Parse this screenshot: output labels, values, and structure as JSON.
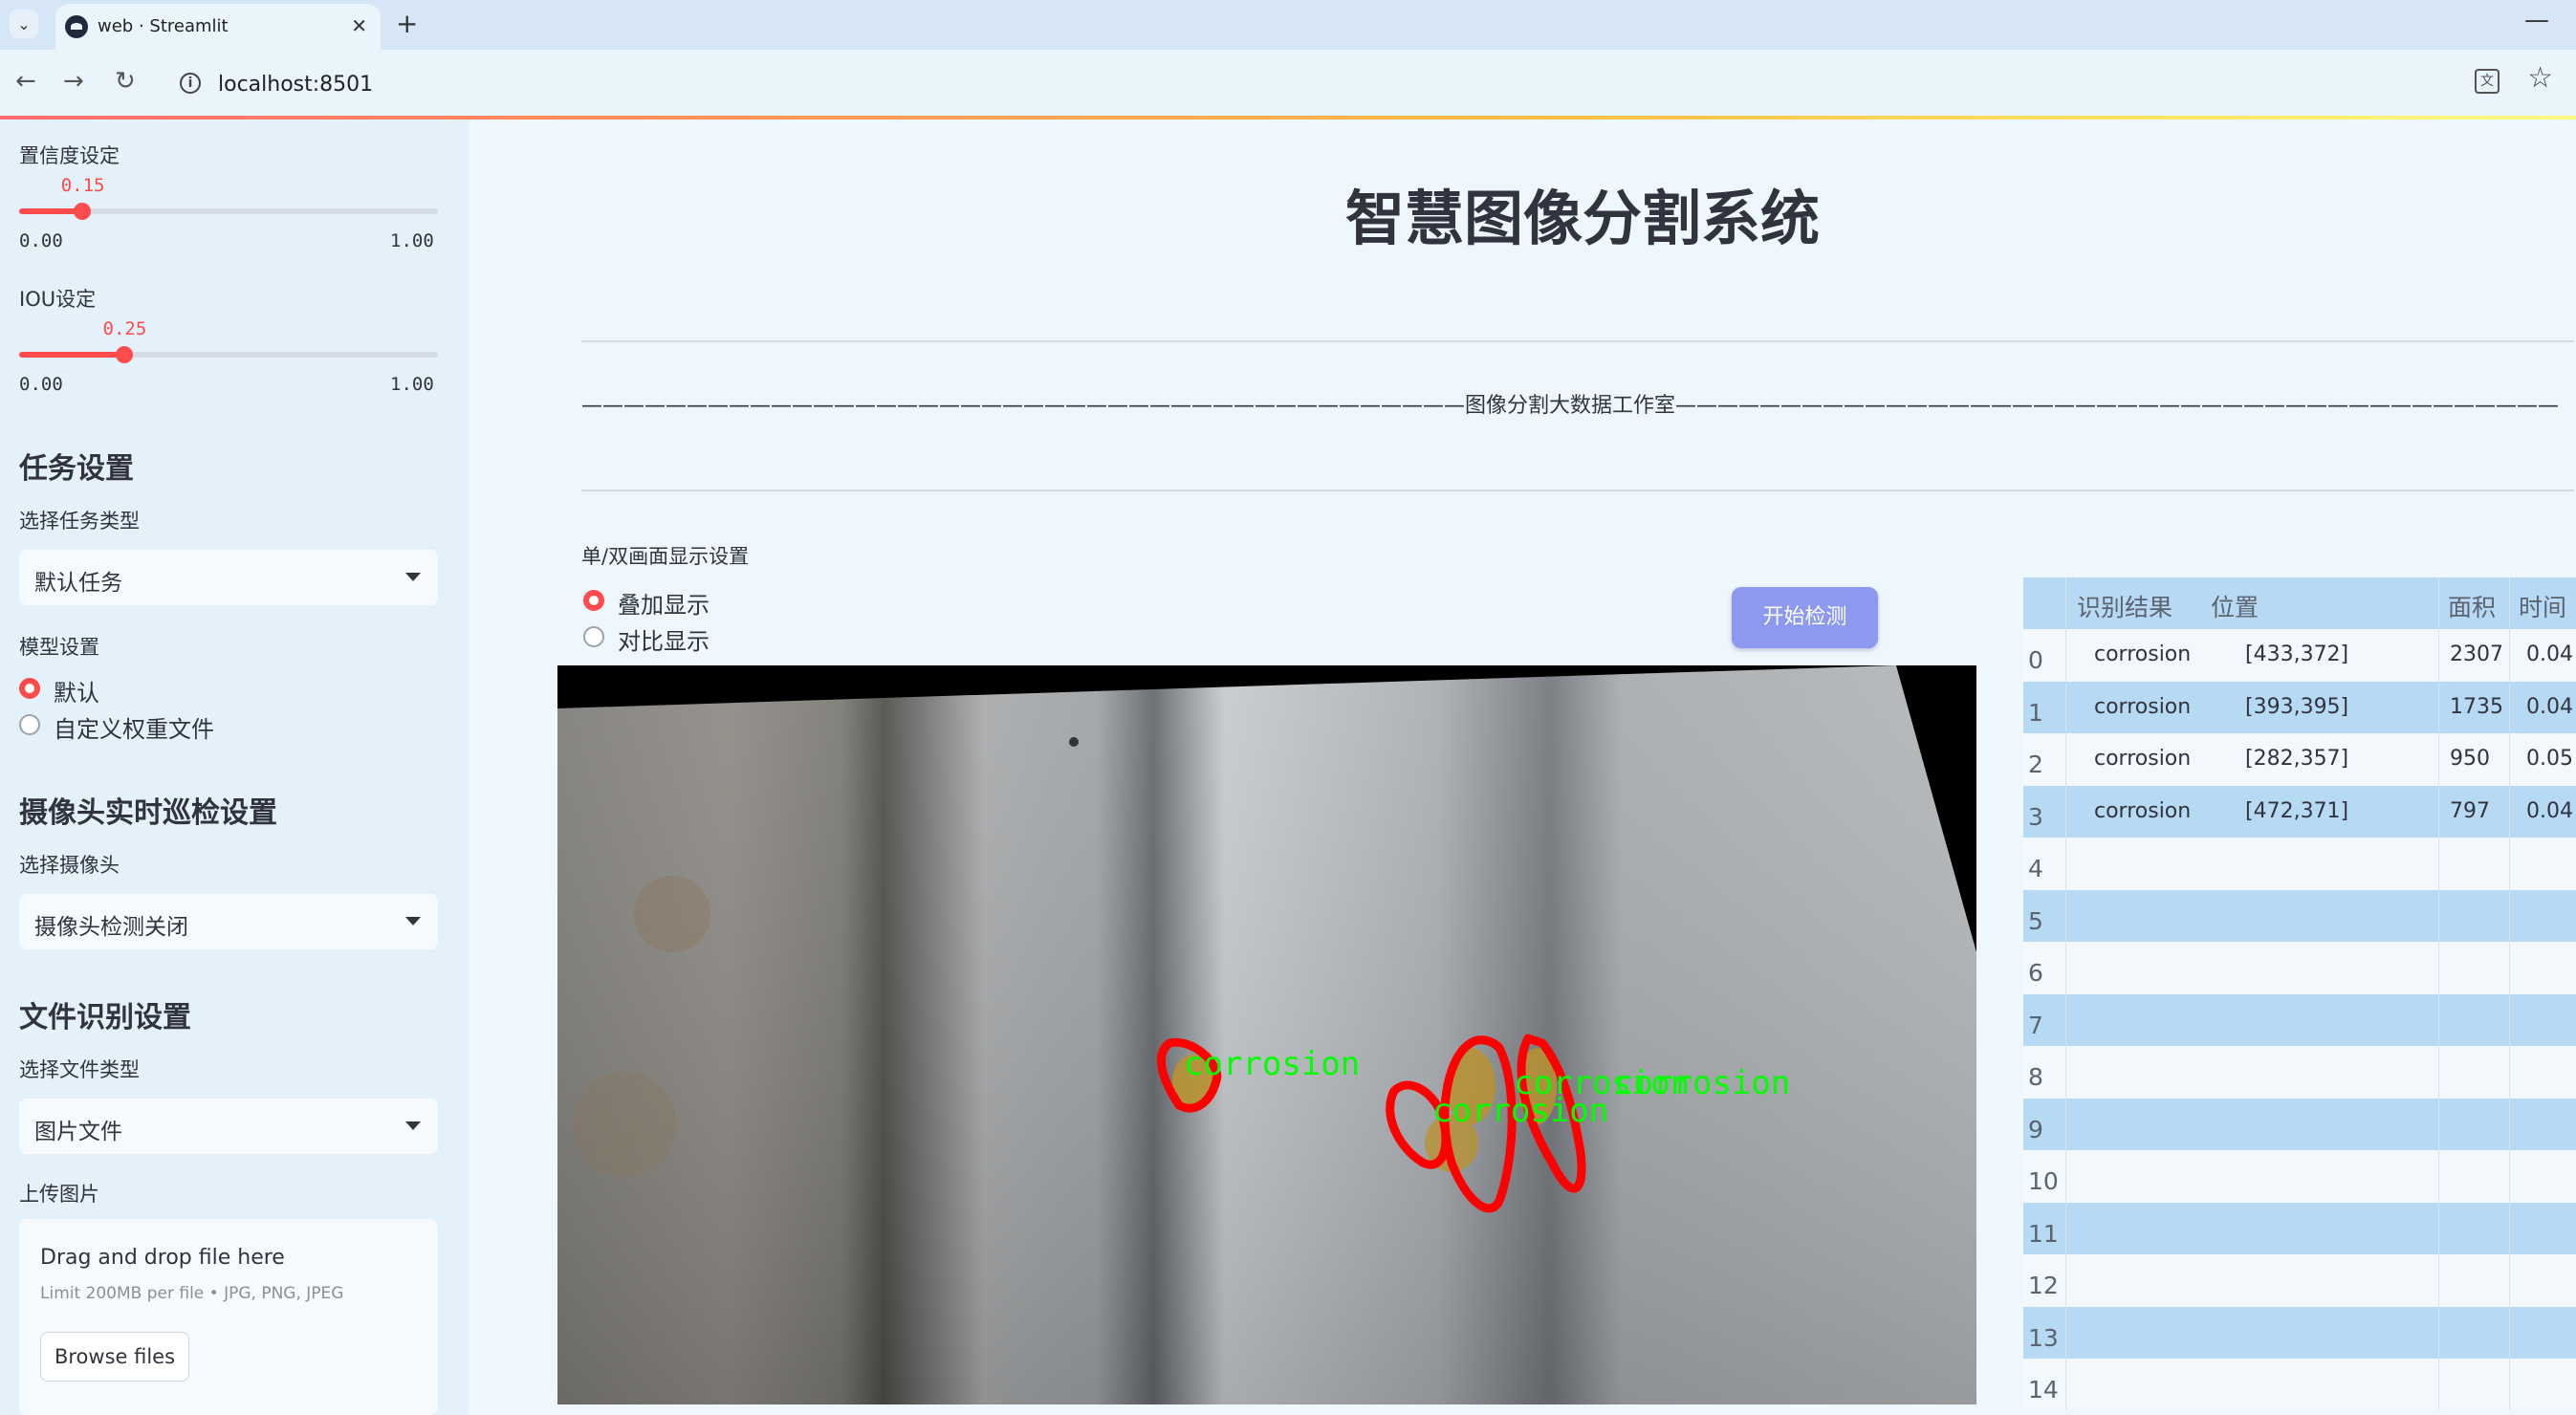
{
  "browser": {
    "tab_title": "web · Streamlit",
    "url": "localhost:8501"
  },
  "sidebar": {
    "confidence": {
      "label": "置信度设定",
      "value": "0.15",
      "fraction": 0.15,
      "min": "0.00",
      "max": "1.00"
    },
    "iou": {
      "label": "IOU设定",
      "value": "0.25",
      "fraction": 0.25,
      "min": "0.00",
      "max": "1.00"
    },
    "task_section": {
      "heading": "任务设置",
      "select_label": "选择任务类型",
      "selected": "默认任务"
    },
    "model_section": {
      "label": "模型设置",
      "options": [
        "默认",
        "自定义权重文件"
      ],
      "selected_index": 0
    },
    "camera_section": {
      "heading": "摄像头实时巡检设置",
      "select_label": "选择摄像头",
      "selected": "摄像头检测关闭"
    },
    "file_section": {
      "heading": "文件识别设置",
      "select_label": "选择文件类型",
      "selected": "图片文件"
    },
    "upload": {
      "label": "上传图片",
      "drop_text": "Drag and drop file here",
      "limit_text": "Limit 200MB per file • JPG, PNG, JPEG",
      "browse_label": "Browse files"
    }
  },
  "main": {
    "title": "智慧图像分割系统",
    "banner": "——————————————————————————————————————————图像分割大数据工作室——————————————————————————————————————————",
    "display_label": "单/双画面显示设置",
    "display_options": [
      "叠加显示",
      "对比显示"
    ],
    "display_selected_index": 0,
    "detect_button": "开始检测",
    "detection_labels": [
      "corrosion",
      "corrosion",
      "corrosion",
      "corrosion"
    ]
  },
  "table": {
    "headers": [
      "识别结果",
      "位置",
      "面积",
      "时间"
    ],
    "rows": [
      {
        "index": "0",
        "result": "corrosion",
        "position": "[433,372]",
        "area": "2307",
        "time": "0.04"
      },
      {
        "index": "1",
        "result": "corrosion",
        "position": "[393,395]",
        "area": "1735",
        "time": "0.04"
      },
      {
        "index": "2",
        "result": "corrosion",
        "position": "[282,357]",
        "area": "950",
        "time": "0.05"
      },
      {
        "index": "3",
        "result": "corrosion",
        "position": "[472,371]",
        "area": "797",
        "time": "0.04"
      },
      {
        "index": "4",
        "result": "",
        "position": "",
        "area": "",
        "time": ""
      },
      {
        "index": "5",
        "result": "",
        "position": "",
        "area": "",
        "time": ""
      },
      {
        "index": "6",
        "result": "",
        "position": "",
        "area": "",
        "time": ""
      },
      {
        "index": "7",
        "result": "",
        "position": "",
        "area": "",
        "time": ""
      },
      {
        "index": "8",
        "result": "",
        "position": "",
        "area": "",
        "time": ""
      },
      {
        "index": "9",
        "result": "",
        "position": "",
        "area": "",
        "time": ""
      },
      {
        "index": "10",
        "result": "",
        "position": "",
        "area": "",
        "time": ""
      },
      {
        "index": "11",
        "result": "",
        "position": "",
        "area": "",
        "time": ""
      },
      {
        "index": "12",
        "result": "",
        "position": "",
        "area": "",
        "time": ""
      },
      {
        "index": "13",
        "result": "",
        "position": "",
        "area": "",
        "time": ""
      },
      {
        "index": "14",
        "result": "",
        "position": "",
        "area": "",
        "time": ""
      }
    ]
  },
  "colors": {
    "accent": "#ff4b4b",
    "button": "#8c99ee",
    "mask_outline": "#ff0000",
    "label_text": "#00ff00"
  }
}
